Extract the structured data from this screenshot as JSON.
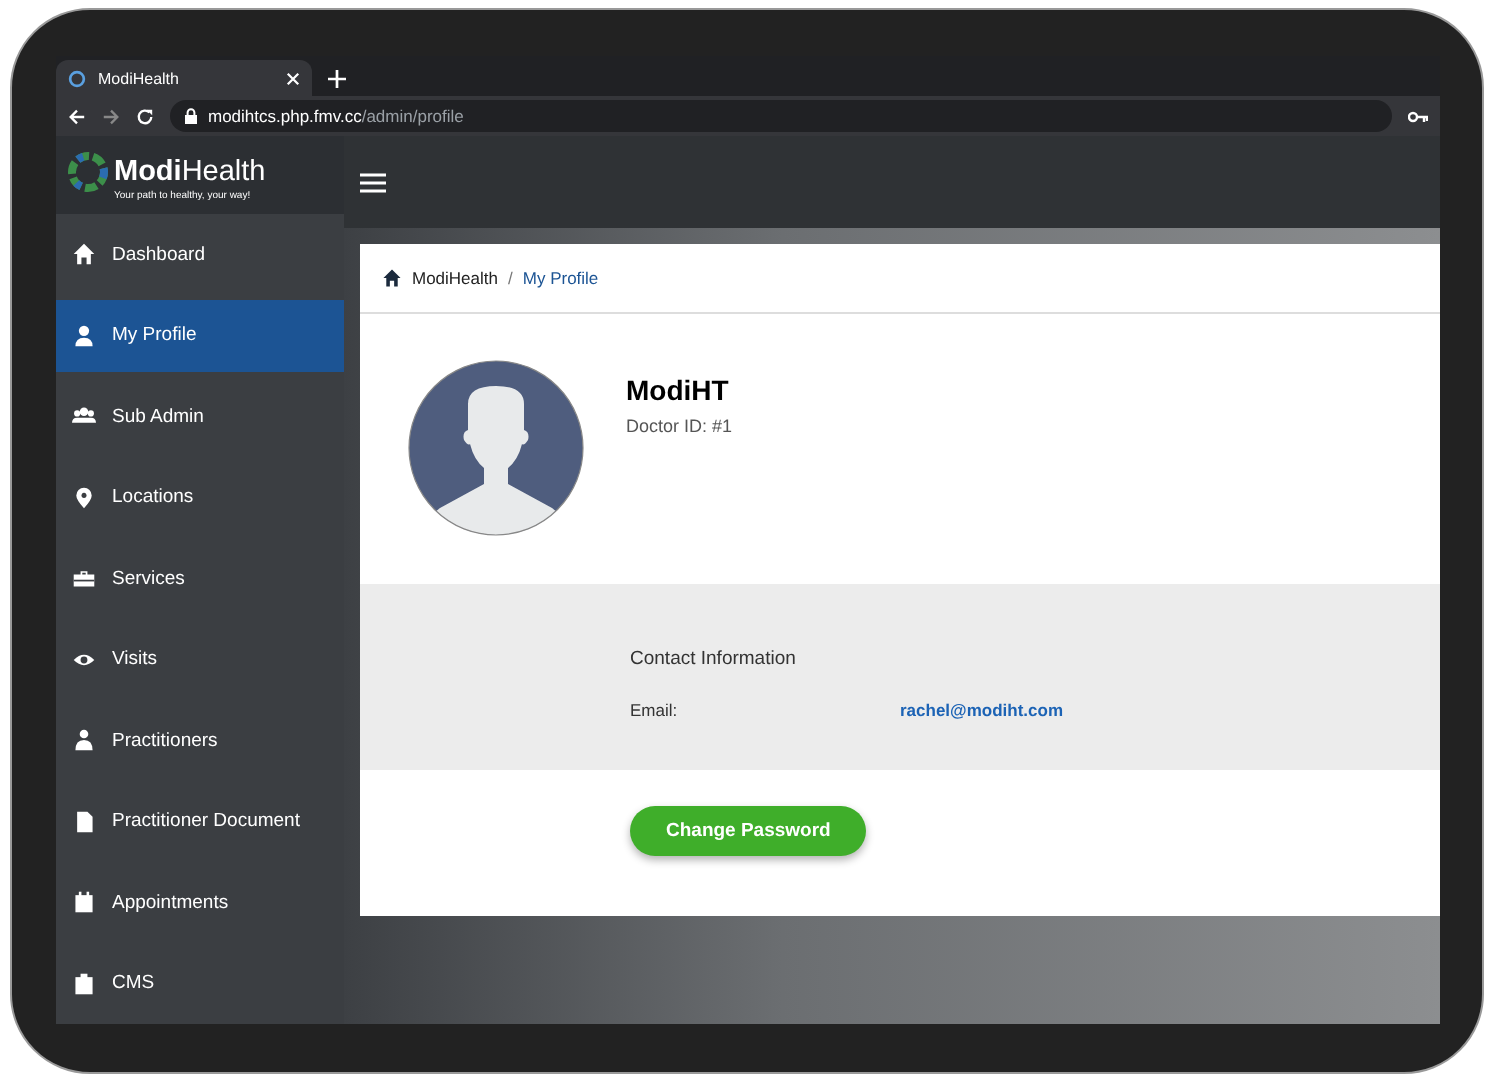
{
  "browser": {
    "tab_title": "ModiHealth",
    "url_host": "modihtcs.php.fmv.cc",
    "url_path": "/admin/profile"
  },
  "sidebar": {
    "logo": "**Modi**Health",
    "tagline": "Your path to healthy, your way!",
    "items": [
      {
        "label": "Dashboard",
        "selected": false
      },
      {
        "label": "My Profile",
        "selected": true
      },
      {
        "label": "Sub Admin",
        "selected": false
      },
      {
        "label": "Locations",
        "selected": false
      },
      {
        "label": "Services",
        "selected": false
      },
      {
        "label": "Visits",
        "selected": false
      },
      {
        "label": "Practitioners",
        "selected": false
      },
      {
        "label": "Practitioner Document",
        "selected": false
      },
      {
        "label": "Appointments",
        "selected": false
      },
      {
        "label": "CMS",
        "selected": false
      }
    ]
  },
  "breadcrumb": {
    "home": "ModiHealth",
    "separator": "/",
    "current": "My Profile"
  },
  "profile": {
    "name": "ModiHT",
    "doctor_id": "Doctor ID: #1"
  },
  "contact": {
    "heading": "Contact Information",
    "rows": [
      {
        "label": "Email:",
        "value": "rachel@modiht.com"
      }
    ]
  },
  "button": "Change Password"
}
